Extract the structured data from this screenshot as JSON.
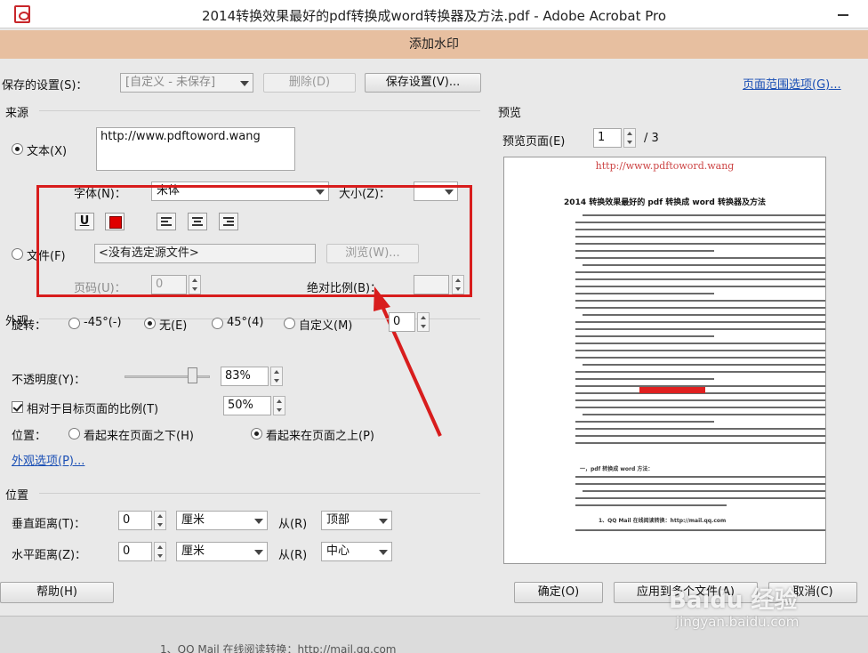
{
  "window": {
    "title": "2014转换效果最好的pdf转换成word转换器及方法.pdf - Adobe Acrobat Pro"
  },
  "dialog": {
    "title": "添加水印"
  },
  "settings": {
    "label": "保存的设置(S)：",
    "selected": "[自定义 - 未保存]",
    "delete_label": "删除(D)",
    "save_label": "保存设置(V)...",
    "page_range_label": "页面范围选项(G)..."
  },
  "source": {
    "section_label": "来源",
    "text_option": "文本(X)",
    "text_value": "http://www.pdftoword.wang",
    "font_label": "字体(N)：",
    "font_value": "宋体",
    "size_label": "大小(Z)：",
    "size_value": "",
    "file_option": "文件(F)",
    "file_value": "<没有选定源文件>",
    "browse_label": "浏览(W)...",
    "page_label": "页码(U)：",
    "page_value": "0",
    "abs_scale_label": "绝对比例(B)：",
    "abs_scale_value": ""
  },
  "appearance": {
    "section_label": "外观",
    "rotation_label": "旋转：",
    "rot_neg45": "-45°(-)",
    "rot_none": "无(E)",
    "rot_45": "45°(4)",
    "rot_custom": "自定义(M)",
    "rot_custom_value": "0",
    "opacity_label": "不透明度(Y)：",
    "opacity_value": "83%",
    "opacity_level": 0.83,
    "relative_scale_label": "相对于目标页面的比例(T)",
    "relative_scale_value": "50%",
    "position_label": "位置：",
    "pos_below": "看起来在页面之下(H)",
    "pos_above": "看起来在页面之上(P)",
    "options_link": "外观选项(P)..."
  },
  "position": {
    "section_label": "位置",
    "vertical_label": "垂直距离(T)：",
    "vertical_value": "0",
    "vertical_unit": "厘米",
    "vertical_from_label": "从(R)",
    "vertical_from": "顶部",
    "horizontal_label": "水平距离(Z)：",
    "horizontal_value": "0",
    "horizontal_unit": "厘米",
    "horizontal_from_label": "从(R)",
    "horizontal_from": "中心"
  },
  "preview": {
    "section_label": "预览",
    "page_label": "预览页面(E)",
    "page_value": "1",
    "page_total": "/ 3",
    "watermark_text": "http://www.pdftoword.wang",
    "doc_title": "2014 转换效果最好的 pdf 转换成 word 转换器及方法",
    "section_heading": "一，pdf 转换成 word 方法：",
    "mail_line": "1、QQ Mail 在线阅读转换：http://mail.qq.com"
  },
  "footer": {
    "help_label": "帮助(H)",
    "ok_label": "确定(O)",
    "apply_label": "应用到多个文件(A)",
    "cancel_label": "取消(C)"
  },
  "background": {
    "peek_text": "1、QQ Mail 在线阅读转换：http://mail.qq.com"
  },
  "overlay": {
    "brand": "Baidu 经验",
    "url": "jingyan.baidu.com"
  },
  "colors": {
    "accent": "#d81d1d",
    "dialog_title_bg": "#e7bfa0",
    "link": "#1a4fb5"
  }
}
